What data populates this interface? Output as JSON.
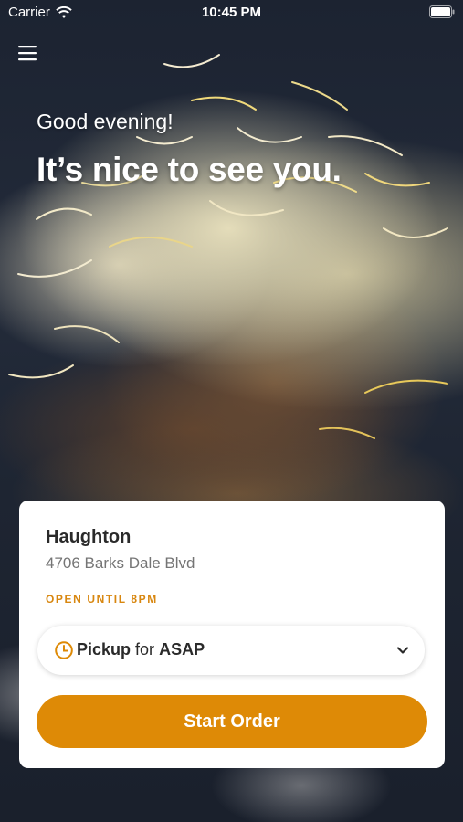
{
  "status_bar": {
    "carrier": "Carrier",
    "time": "10:45 PM"
  },
  "icons": {
    "menu": "hamburger-menu-icon",
    "wifi": "wifi-icon",
    "battery": "battery-icon",
    "clock": "clock-icon",
    "chevron": "chevron-down-icon"
  },
  "hero": {
    "greeting": "Good evening!",
    "headline": "It’s nice to see you."
  },
  "store_card": {
    "name": "Haughton",
    "address": "4706 Barks Dale Blvd",
    "hours": "OPEN UNTIL 8PM",
    "order_type": "Pickup",
    "connector": "for",
    "time_choice": "ASAP",
    "start_label": "Start Order"
  },
  "colors": {
    "accent": "#de8a06",
    "hours_text": "#d88710"
  }
}
